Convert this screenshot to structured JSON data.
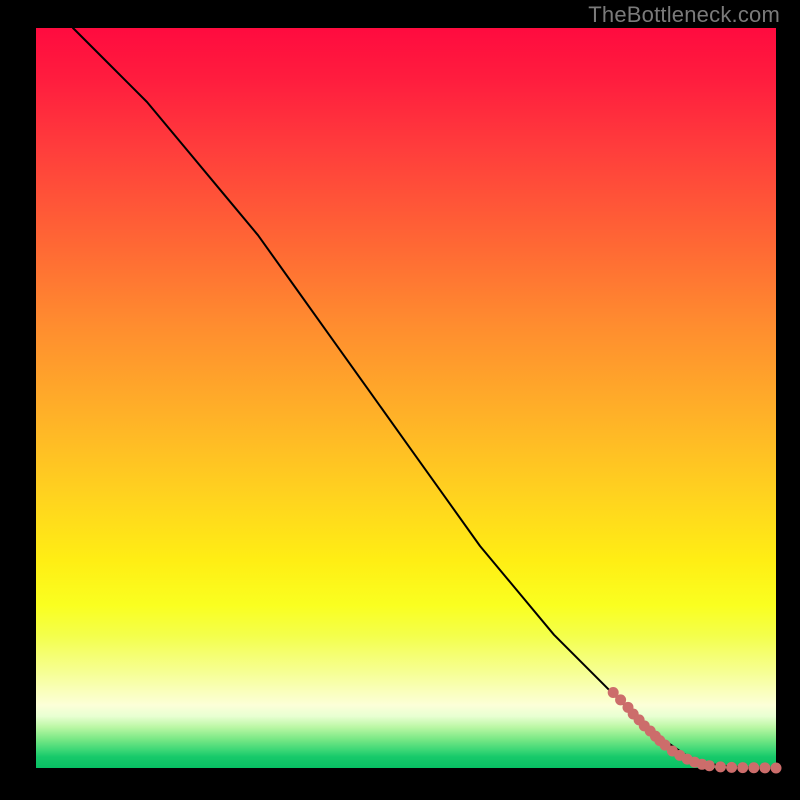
{
  "watermark": "TheBottleneck.com",
  "chart_data": {
    "type": "line",
    "title": "",
    "xlabel": "",
    "ylabel": "",
    "xlim": [
      0,
      100
    ],
    "ylim": [
      0,
      100
    ],
    "grid": false,
    "legend": false,
    "gradient_stops": [
      {
        "pos": 0.0,
        "color": "#ff0b3f"
      },
      {
        "pos": 0.3,
        "color": "#ff6a34"
      },
      {
        "pos": 0.63,
        "color": "#ffd21f"
      },
      {
        "pos": 0.8,
        "color": "#f6ff60"
      },
      {
        "pos": 0.93,
        "color": "#e8ffd2"
      },
      {
        "pos": 1.0,
        "color": "#08c064"
      }
    ],
    "series": [
      {
        "name": "curve",
        "color": "#000000",
        "stroke_width": 2,
        "x": [
          5,
          10,
          15,
          20,
          25,
          30,
          35,
          40,
          45,
          50,
          55,
          60,
          65,
          70,
          75,
          80,
          83,
          86,
          88,
          90,
          92,
          94,
          96,
          98,
          100
        ],
        "y": [
          100,
          95,
          90,
          84,
          78,
          72,
          65,
          58,
          51,
          44,
          37,
          30,
          24,
          18,
          13,
          8,
          5,
          3,
          1.6,
          0.8,
          0.4,
          0.2,
          0.1,
          0.05,
          0.0
        ]
      }
    ],
    "points": {
      "name": "dots",
      "color": "#cc6d6b",
      "radius": 5.5,
      "x": [
        78,
        79,
        80,
        80.7,
        81.5,
        82.2,
        83,
        83.7,
        84.3,
        85,
        86,
        87,
        88,
        89,
        90,
        91,
        92.5,
        94,
        95.5,
        97,
        98.5,
        100
      ],
      "y": [
        10.2,
        9.2,
        8.2,
        7.3,
        6.5,
        5.7,
        5.0,
        4.3,
        3.7,
        3.1,
        2.3,
        1.7,
        1.2,
        0.8,
        0.5,
        0.3,
        0.15,
        0.08,
        0.05,
        0.03,
        0.02,
        0.0
      ]
    }
  }
}
